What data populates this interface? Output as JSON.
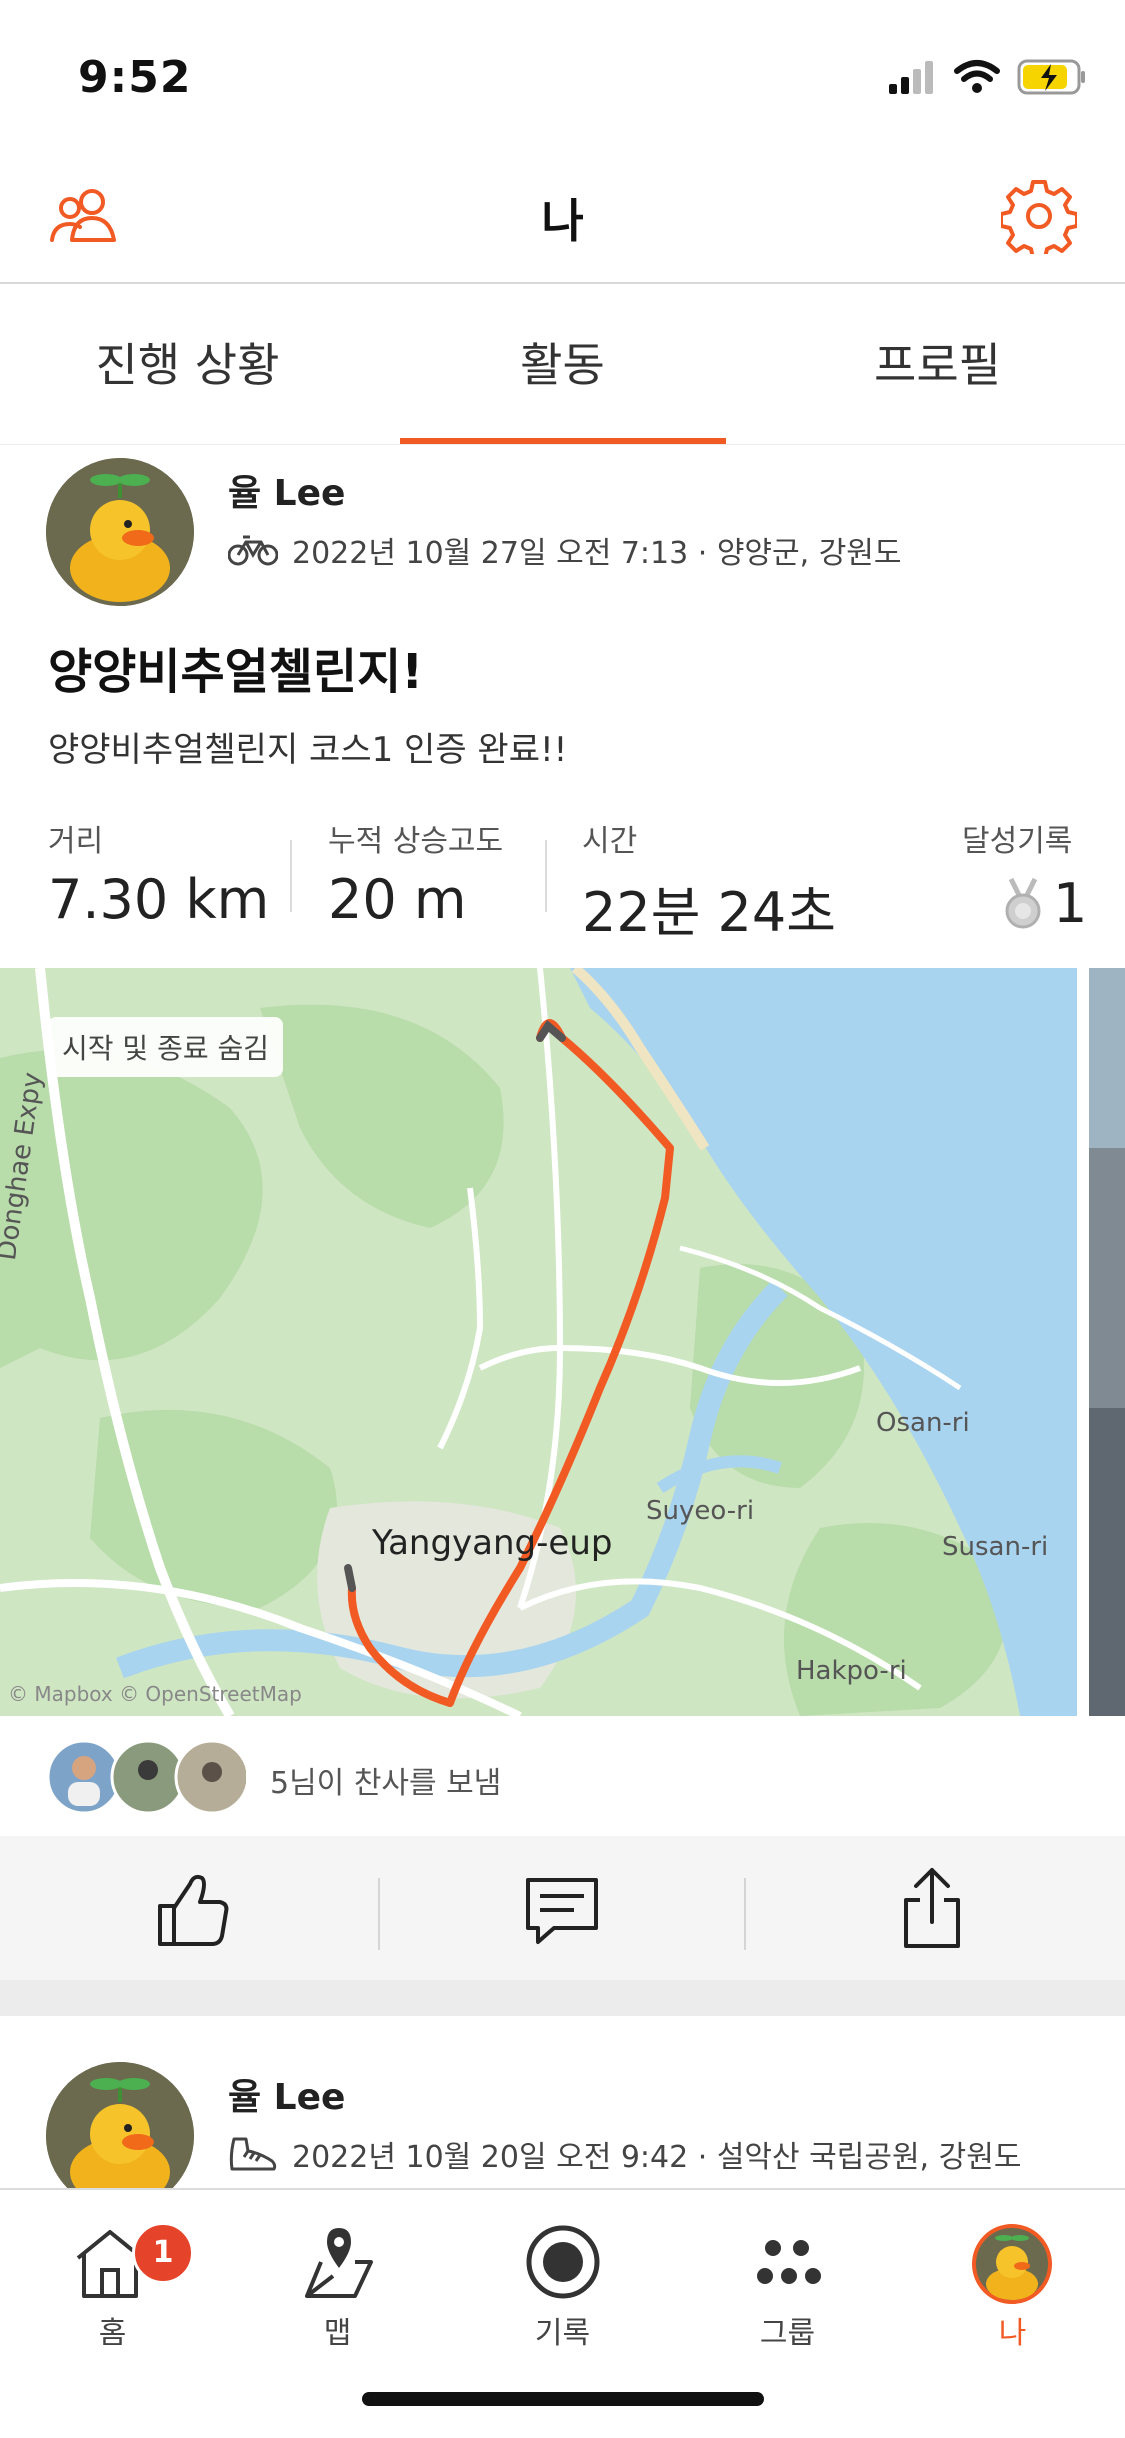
{
  "status_bar": {
    "time": "9:52"
  },
  "header": {
    "title": "나"
  },
  "tabs": [
    {
      "label": "진행 상황"
    },
    {
      "label": "활동"
    },
    {
      "label": "프로필"
    }
  ],
  "activity": {
    "athlete": "율 Lee",
    "meta": "2022년 10월 27일 오전 7:13 · 양양군, 강원도",
    "activity_icon": "bike-icon",
    "title": "양양비추얼첼린지!",
    "description": "양양비추얼첼린지 코스1 인증 완료!!",
    "stats": {
      "distance_label": "거리",
      "distance_value": "7.30 km",
      "elevation_label": "누적 상승고도",
      "elevation_value": "20 m",
      "time_label": "시간",
      "time_value": "22분 24초",
      "achievements_label": "달성기록",
      "achievements_value": "1"
    },
    "map": {
      "hide_start_end": "시작 및 종료 숨김",
      "labels": {
        "donghae": "Donghae Expy",
        "yangyang": "Yangyang-eup",
        "osan": "Osan-ri",
        "suyeo": "Suyeo-ri",
        "susan": "Susan-ri",
        "hakpo": "Hakpo-ri",
        "attribution": "© Mapbox © OpenStreetMap"
      },
      "colors": {
        "route": "#f25a24",
        "water": "#a9d4ef",
        "land": "#cfe6c3"
      }
    },
    "kudos_text": "5님이 찬사를 보냄"
  },
  "next_activity": {
    "athlete": "율 Lee",
    "meta": "2022년 10월 20일 오전 9:42 · 설악산 국립공원, 강원도",
    "activity_icon": "hiking-shoe-icon"
  },
  "bottom_nav": {
    "items": [
      {
        "label": "홈",
        "icon": "home-icon",
        "badge": "1"
      },
      {
        "label": "맵",
        "icon": "map-icon"
      },
      {
        "label": "기록",
        "icon": "record-icon"
      },
      {
        "label": "그룹",
        "icon": "groups-icon"
      },
      {
        "label": "나",
        "icon": "avatar-icon"
      }
    ]
  },
  "colors": {
    "accent": "#f25a24",
    "badge": "#e6432b"
  }
}
